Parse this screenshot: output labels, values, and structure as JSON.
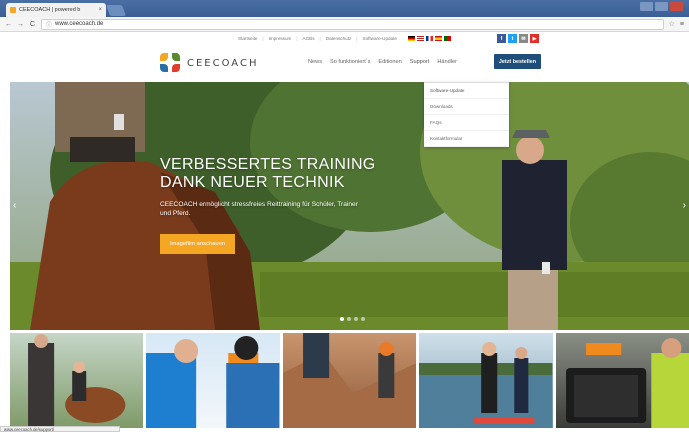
{
  "browser": {
    "tab_title": "CEECOACH | powered b",
    "tab_close": "×",
    "url": "www.ceecoach.de",
    "nav_back": "←",
    "nav_forward": "→",
    "nav_reload": "C",
    "info_glyph": "ⓘ",
    "bookmark_glyph": "☆",
    "menu_glyph": "≡"
  },
  "utility": {
    "links": [
      "Startseite",
      "Impressum",
      "AGBs",
      "Datenschutz",
      "Software-Update"
    ],
    "separator": "|",
    "social": [
      {
        "label": "f",
        "color": "#3b5998",
        "icon": "facebook-icon"
      },
      {
        "label": "t",
        "color": "#1da1f2",
        "icon": "twitter-icon"
      },
      {
        "label": "✉",
        "color": "#888888",
        "icon": "mail-icon"
      },
      {
        "label": "▶",
        "color": "#e52d27",
        "icon": "youtube-icon"
      }
    ]
  },
  "header": {
    "logo_text": "CEECOACH",
    "nav": [
      "News",
      "So funktioniert´s",
      "Editionen",
      "Support",
      "Händler"
    ],
    "cta": "Jetzt bestellen"
  },
  "dropdown": {
    "items": [
      "Software-Update",
      "Downloads",
      "FAQs",
      "Kontaktformular"
    ]
  },
  "hero": {
    "title_line1": "VERBESSERTES TRAINING",
    "title_line2": "DANK NEUER TECHNIK",
    "subtitle": "CEECOACH ermöglicht stressfreies Reittraining für Schüler, Trainer und Pferd.",
    "button": "Imagefilm anschauen",
    "prev": "‹",
    "next": "›",
    "slides_total": 4,
    "slide_active": 1
  },
  "status": {
    "text": "www.ceecoach.de/support/"
  },
  "colors": {
    "accent": "#f5a623",
    "cta": "#1f4e7a"
  }
}
